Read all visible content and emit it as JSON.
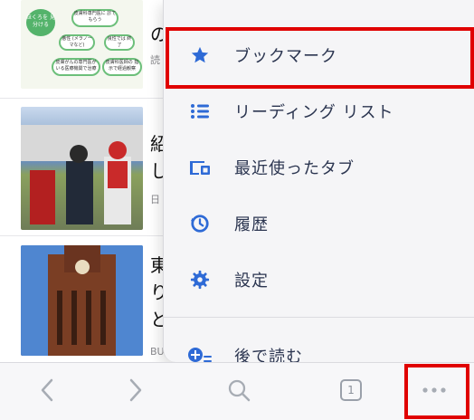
{
  "news": {
    "item1": {
      "headline_fragment": "の",
      "source_fragment": "読",
      "thumb_texts": [
        "ほくろを 見分ける",
        "皮膚科専門医に 診てもらう",
        "悪性 (メラノーマなど)",
        "良性では 終了",
        "皮膚がんの専門医が いる医療機関で治療",
        "皮膚科医師の 指示で経過観察"
      ]
    },
    "item2": {
      "headline_fragment": "紹し",
      "source_fragment": "日"
    },
    "item3": {
      "headline_fragment": "東りと",
      "source_fragment": "BU"
    }
  },
  "menu": {
    "items": [
      {
        "label": "ブックマーク",
        "icon": "star-icon"
      },
      {
        "label": "リーディング リスト",
        "icon": "list-icon"
      },
      {
        "label": "最近使ったタブ",
        "icon": "recent-tabs-icon"
      },
      {
        "label": "履歴",
        "icon": "history-icon"
      },
      {
        "label": "設定",
        "icon": "gear-icon"
      },
      {
        "label": "後で読む",
        "icon": "read-later-icon"
      }
    ]
  },
  "toolbar": {
    "tab_count": "1",
    "buttons": [
      "back",
      "forward",
      "search",
      "tabs",
      "more"
    ]
  },
  "colors": {
    "accent": "#2e6ad6",
    "highlight": "#e00000",
    "menu_text": "#2b3550"
  }
}
